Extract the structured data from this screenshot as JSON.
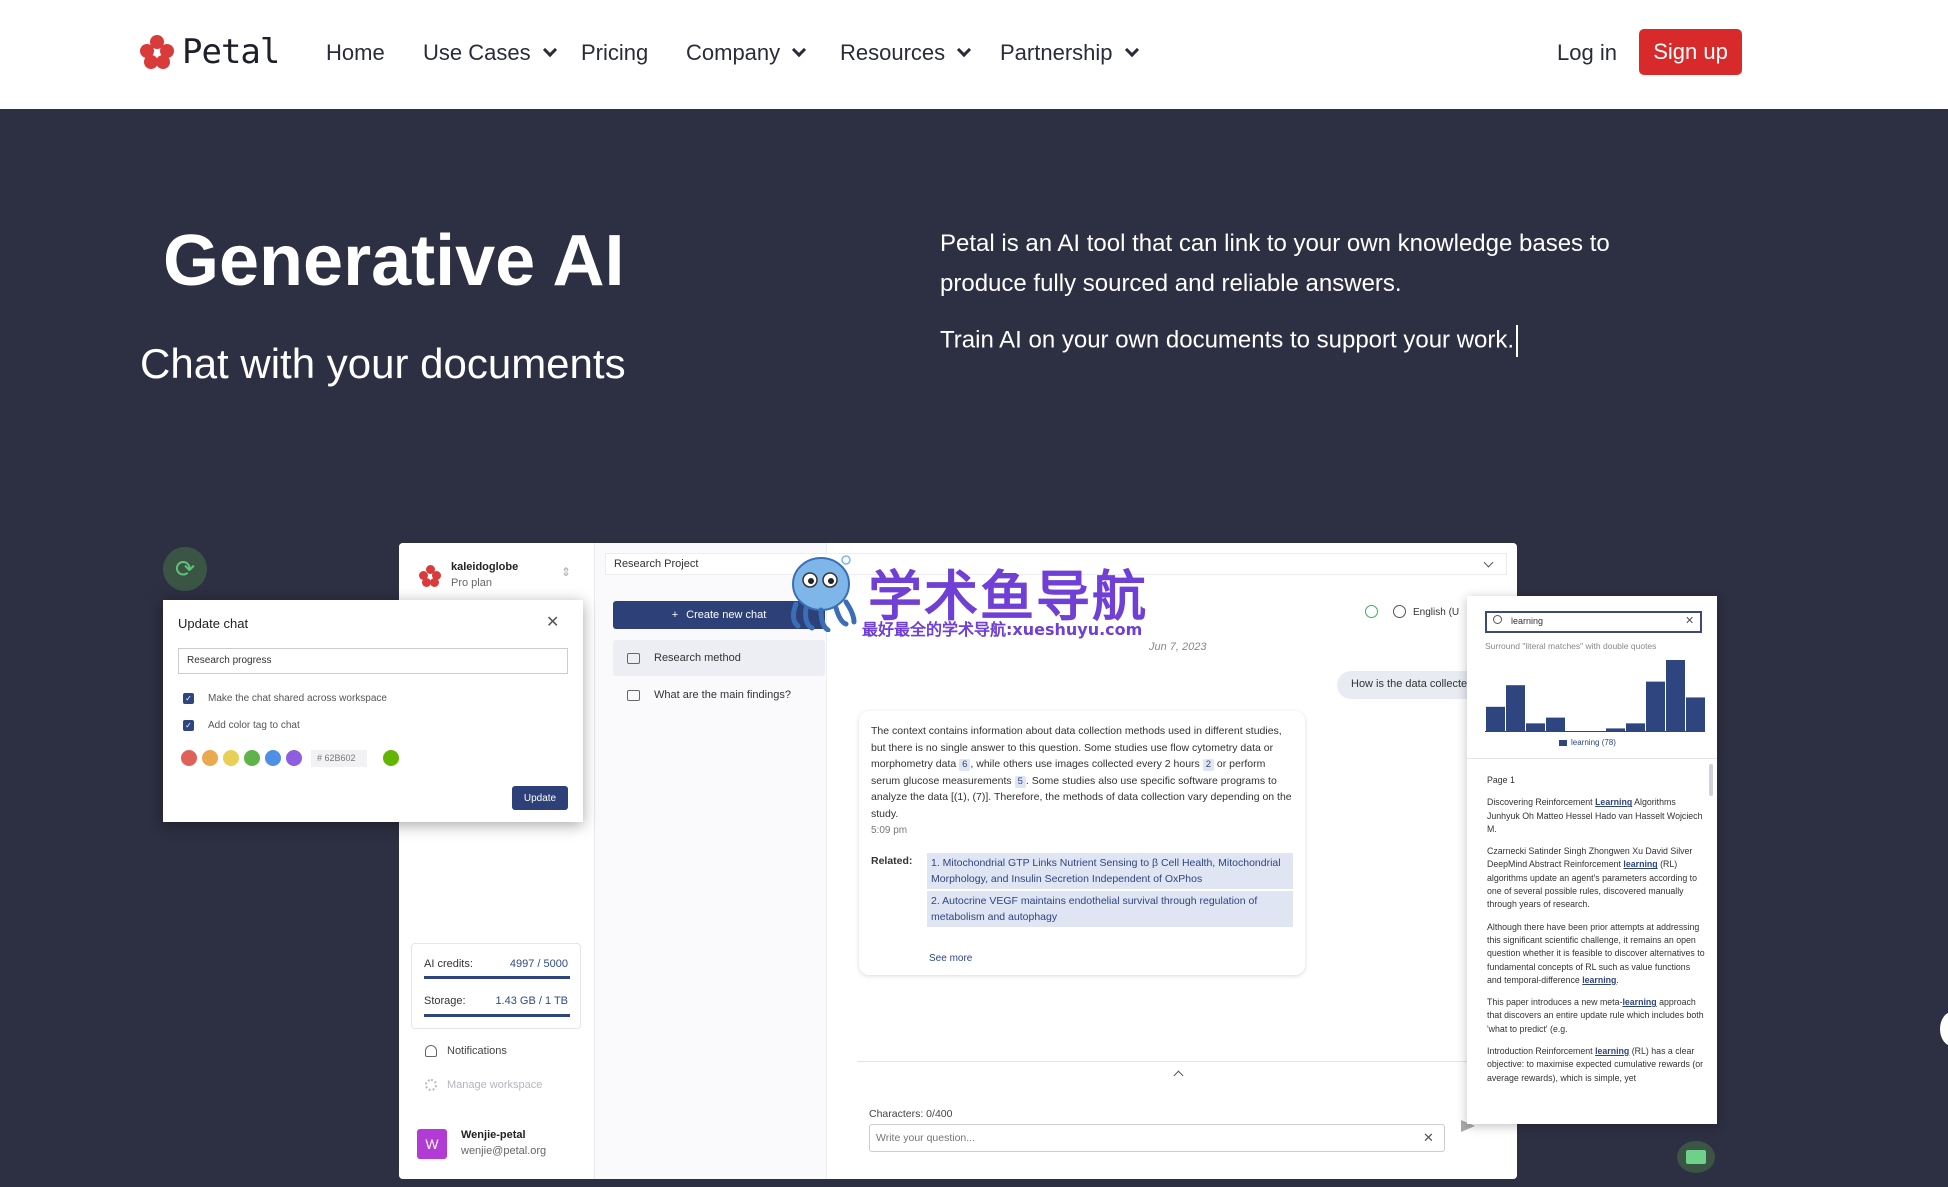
{
  "nav": {
    "brand": "Petal",
    "items": [
      {
        "label": "Home",
        "dropdown": false
      },
      {
        "label": "Use Cases",
        "dropdown": true
      },
      {
        "label": "Pricing",
        "dropdown": false
      },
      {
        "label": "Company",
        "dropdown": true
      },
      {
        "label": "Resources",
        "dropdown": true
      },
      {
        "label": "Partnership",
        "dropdown": true
      }
    ],
    "login": "Log in",
    "signup": "Sign up"
  },
  "hero": {
    "title": "Generative AI",
    "subtitle": "Chat with your documents",
    "paragraph1": "Petal is an AI tool that can link to your own knowledge bases to produce fully sourced and reliable answers.",
    "paragraph2": "Train AI on your own documents to support your work."
  },
  "app": {
    "workspace": {
      "name": "kaleidoglobe",
      "plan": "Pro plan"
    },
    "stats": {
      "credits_label": "AI credits:",
      "credits_value": "4997 / 5000",
      "credits_fraction": 0.9994,
      "storage_label": "Storage:",
      "storage_value": "1.43 GB / 1 TB",
      "storage_fraction": 1.0
    },
    "side_links": {
      "notifications": "Notifications",
      "manage": "Manage workspace"
    },
    "user": {
      "initial": "W",
      "name": "Wenjie-petal",
      "email": "wenjie@petal.org"
    },
    "project": "Research Project",
    "new_chat": "Create new chat",
    "chats": [
      "Research method",
      "What are the main findings?"
    ],
    "language": "English (U",
    "date": "Jun 7, 2023",
    "question": "How is the data collected?",
    "answer": {
      "parts": [
        "The context contains information about data collection methods used in different studies, but there is no single answer to this question. Some studies use flow cytometry data or morphometry data ",
        "6",
        ", while others use images collected every 2 hours ",
        "2",
        " or perform serum glucose measurements ",
        "5",
        ". Some studies also use specific software programs to analyze the data [(1), (7)]. Therefore, the methods of data collection vary depending on the study."
      ],
      "time": "5:09 pm",
      "related_label": "Related:",
      "related": [
        "1. Mitochondrial GTP Links Nutrient Sensing to β Cell Health, Mitochondrial Morphology, and Insulin Secretion Independent of OxPhos",
        "2. Autocrine VEGF maintains endothelial survival through regulation of metabolism and autophagy"
      ],
      "see_more": "See more"
    },
    "input": {
      "chars": "Characters: 0/400",
      "placeholder": "Write your question..."
    }
  },
  "dialog": {
    "title": "Update chat",
    "input_value": "Research progress",
    "checks": [
      "Make the chat shared across workspace",
      "Add color tag to chat"
    ],
    "swatches": [
      "#e0605a",
      "#eaa84f",
      "#e8cf55",
      "#5fb349",
      "#4f8fe6",
      "#8f5ee0"
    ],
    "hex_value": "62B602",
    "selected_color": "#62b602",
    "button": "Update"
  },
  "search_panel": {
    "query": "learning",
    "hint": "Surround \"literal matches\" with double quotes",
    "histogram": [
      0.35,
      0.65,
      0.12,
      0.2,
      0,
      0,
      0.05,
      0.12,
      0.7,
      1.0,
      0.48
    ],
    "legend": "learning (78)",
    "page": "Page 1",
    "paragraphs": [
      [
        "Discovering Reinforcement ",
        "Learning",
        " Algorithms Junhyuk Oh Matteo Hessel Hado van Hasselt Wojciech M."
      ],
      [
        "Czarnecki Satinder Singh Zhongwen Xu David Silver DeepMind Abstract Reinforcement ",
        "learning",
        " (RL) algorithms update an agent's parameters according to one of several possible rules, discovered manually through years of research."
      ],
      [
        "Although there have been prior attempts at addressing this significant scientific challenge, it remains an open question whether it is feasible to discover alternatives to fundamental concepts of RL such as value functions and temporal-difference ",
        "learning",
        "."
      ],
      [
        "This paper introduces a new meta-",
        "learning",
        " approach that discovers an entire update rule which includes both 'what to predict' (e.g."
      ],
      [
        "Introduction Reinforcement ",
        "learning",
        " (RL) has a clear objective: to maximise expected cumulative rewards (or average rewards), which is simple, yet"
      ]
    ]
  },
  "watermark": {
    "title": "学术鱼导航",
    "subtitle": "最好最全的学术导航:xueshuyu.com"
  },
  "colors": {
    "brand_red": "#d82a2a",
    "navy": "#2d4077",
    "hero_bg": "#2d2f42",
    "watermark": "#6f3fd6"
  }
}
